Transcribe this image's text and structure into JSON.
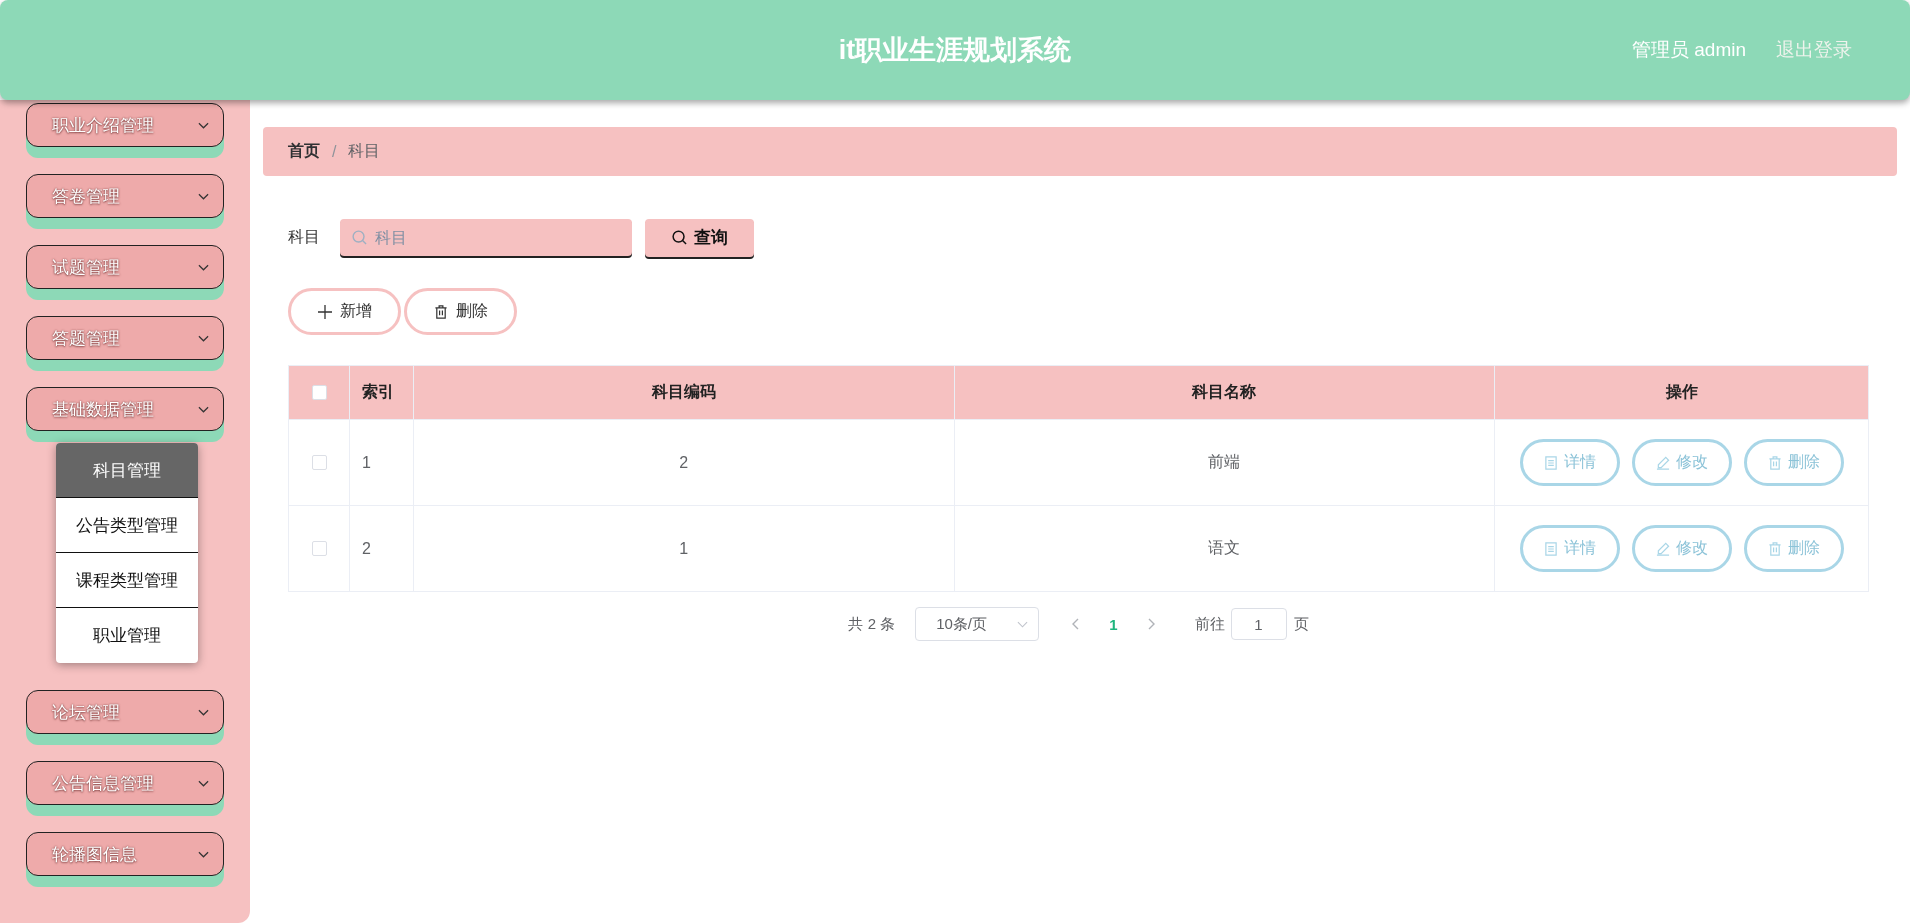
{
  "header": {
    "title": "it职业生涯规划系统",
    "user": "管理员 admin",
    "logout": "退出登录"
  },
  "sidebar": {
    "menus": [
      {
        "label": "职业介绍管理"
      },
      {
        "label": "答卷管理"
      },
      {
        "label": "试题管理"
      },
      {
        "label": "答题管理"
      },
      {
        "label": "基础数据管理",
        "children": [
          {
            "label": "科目管理",
            "selected": true
          },
          {
            "label": "公告类型管理",
            "selected": false
          },
          {
            "label": "课程类型管理",
            "selected": false
          },
          {
            "label": "职业管理",
            "selected": false
          }
        ]
      },
      {
        "label": "论坛管理"
      },
      {
        "label": "公告信息管理"
      },
      {
        "label": "轮播图信息"
      }
    ]
  },
  "breadcrumb": {
    "separator": "/",
    "items": [
      {
        "label": "首页",
        "current": false
      },
      {
        "label": "科目",
        "current": true
      }
    ]
  },
  "search": {
    "label": "科目",
    "placeholder": "科目",
    "button": "查询"
  },
  "actions": [
    {
      "kind": "add",
      "label": "新增"
    },
    {
      "kind": "delete",
      "label": "删除"
    }
  ],
  "table": {
    "header_checked": false,
    "columns": [
      "索引",
      "科目编码",
      "科目名称",
      "操作"
    ],
    "rows": [
      {
        "checked": false,
        "index": "1",
        "code": "2",
        "name": "前端",
        "actions": [
          {
            "kind": "detail",
            "label": "详情"
          },
          {
            "kind": "edit",
            "label": "修改"
          },
          {
            "kind": "delete",
            "label": "删除"
          }
        ]
      },
      {
        "checked": false,
        "index": "2",
        "code": "1",
        "name": "语文",
        "actions": [
          {
            "kind": "detail",
            "label": "详情"
          },
          {
            "kind": "edit",
            "label": "修改"
          },
          {
            "kind": "delete",
            "label": "删除"
          }
        ]
      }
    ]
  },
  "pagination": {
    "total": "共 2 条",
    "page_size": "10条/页",
    "pages": [
      {
        "label": "1",
        "selected": true
      }
    ],
    "goto_label": "前往",
    "goto_value": "1",
    "goto_suffix": "页"
  }
}
